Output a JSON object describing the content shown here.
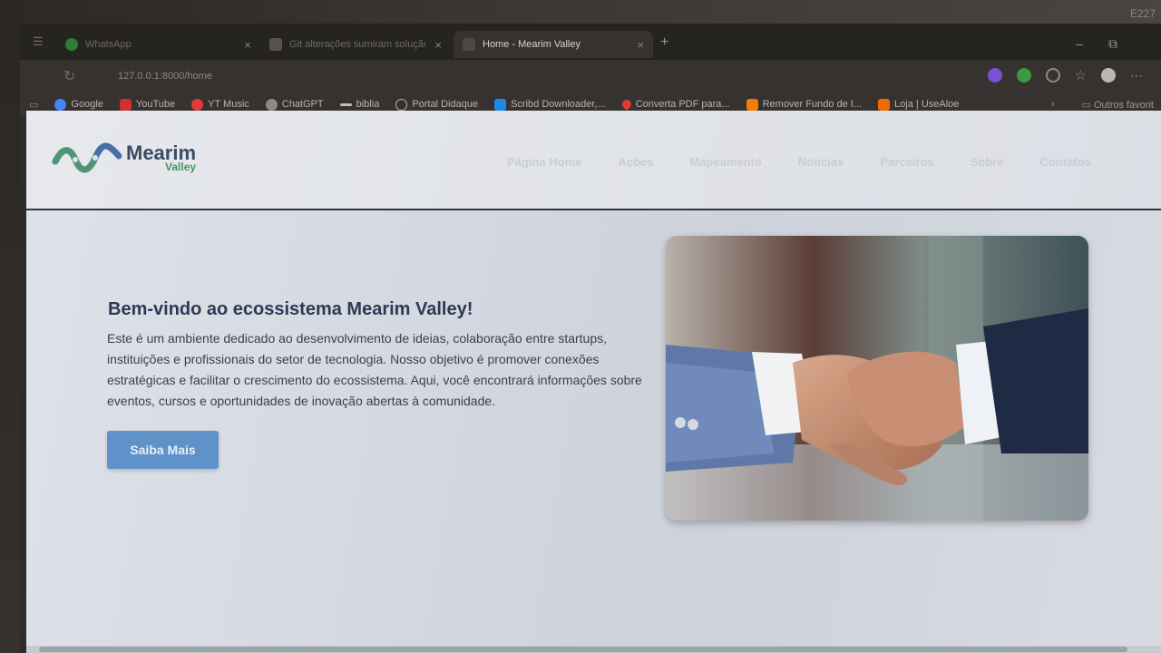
{
  "corner_label": "E227",
  "tabs": [
    {
      "label": "WhatsApp",
      "color": "#2e7d32"
    },
    {
      "label": "Git alterações sumiram solução",
      "color": "#6a5f55"
    },
    {
      "label": "Home - Mearim Valley",
      "color": "#6a5f55"
    }
  ],
  "address": {
    "url": "127.0.0.1:8000/home"
  },
  "bookmarks": [
    {
      "label": "Google",
      "color": "#4285f4"
    },
    {
      "label": "YouTube",
      "color": "#d32f2f"
    },
    {
      "label": "YT Music",
      "color": "#e53935"
    },
    {
      "label": "ChatGPT",
      "color": "#8a8a8a"
    },
    {
      "label": "biblia",
      "color": "#bdbdbd"
    },
    {
      "label": "Portal Didaque",
      "color": "#9e9e9e"
    },
    {
      "label": "Scribd Downloader,...",
      "color": "#1e88e5"
    },
    {
      "label": "Converta PDF para...",
      "color": "#e53935"
    },
    {
      "label": "Remover Fundo de I...",
      "color": "#f57c00"
    },
    {
      "label": "Loja | UseAloe",
      "color": "#ef6c00"
    }
  ],
  "other_bookmarks": "Outros favorit",
  "site": {
    "logo_main": "Mearim",
    "logo_sub": "Valley",
    "nav": [
      "Página Home",
      "Ações",
      "Mapeamento",
      "Notícias",
      "Parceiros",
      "Sobre",
      "Contatos"
    ],
    "hero_title": "Bem-vindo ao ecossistema Mearim Valley!",
    "hero_text": "Este é um ambiente dedicado ao desenvolvimento de ideias, colaboração entre startups, instituições e profissionais do setor de tecnologia. Nosso objetivo é promover conexões estratégicas e facilitar o crescimento do ecossistema. Aqui, você encontrará informações sobre eventos, cursos e oportunidades de inovação abertas à comunidade.",
    "cta_label": "Saiba Mais"
  },
  "colors": {
    "brand_blue": "#3b4a66",
    "brand_green": "#47945f",
    "button": "#5e92c8"
  }
}
